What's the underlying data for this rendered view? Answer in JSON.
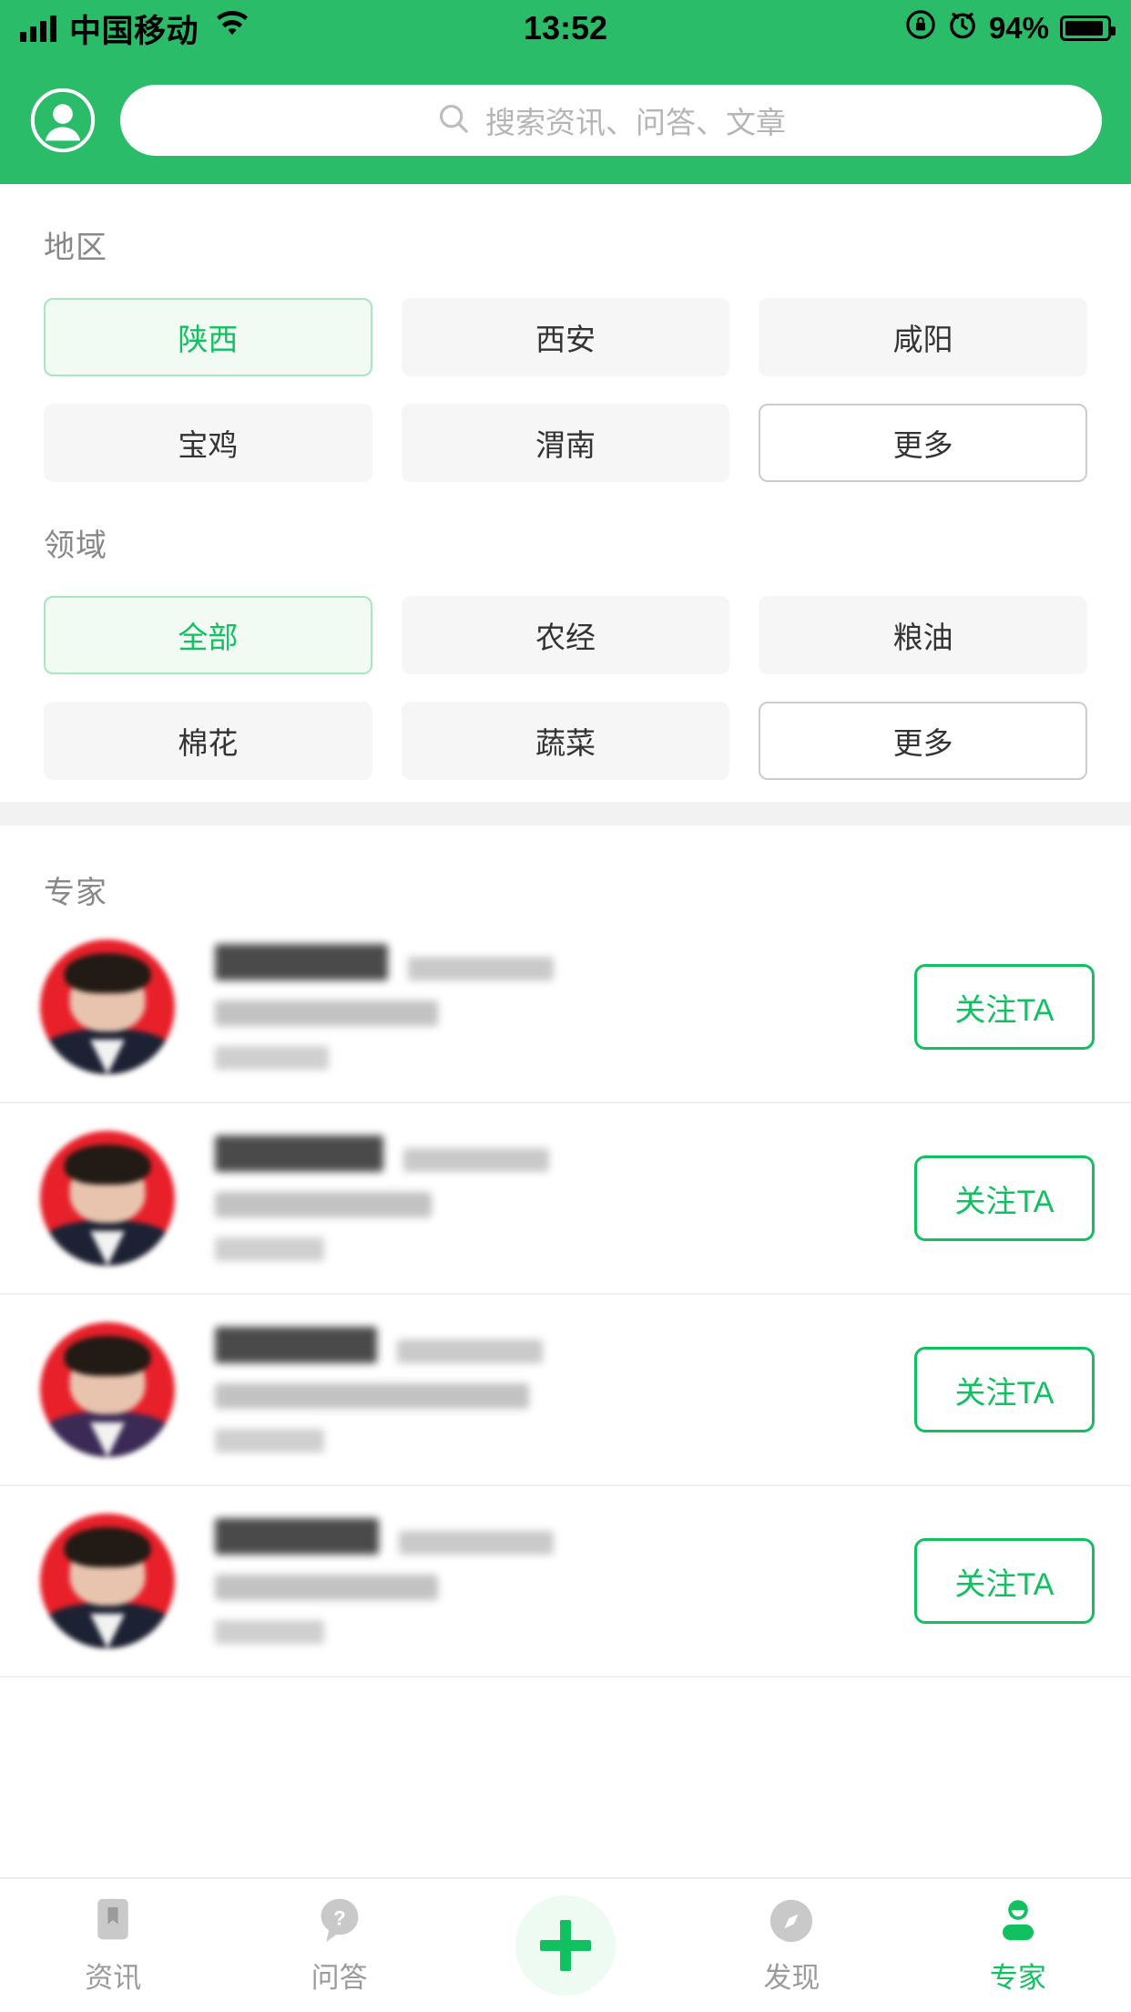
{
  "status_bar": {
    "carrier": "中国移动",
    "time": "13:52",
    "battery_percent": "94%",
    "battery_level": 94,
    "icons": [
      "signal-icon",
      "wifi-icon",
      "rotation-lock-icon",
      "alarm-icon",
      "battery-icon"
    ]
  },
  "header": {
    "avatar_icon": "user-circle-icon",
    "search": {
      "icon": "search-icon",
      "placeholder": "搜索资讯、问答、文章",
      "value": ""
    },
    "accent_color": "#2abc68"
  },
  "filters": {
    "region": {
      "title": "地区",
      "options": [
        {
          "label": "陕西",
          "selected": true,
          "type": "normal"
        },
        {
          "label": "西安",
          "selected": false,
          "type": "normal"
        },
        {
          "label": "咸阳",
          "selected": false,
          "type": "normal"
        },
        {
          "label": "宝鸡",
          "selected": false,
          "type": "normal"
        },
        {
          "label": "渭南",
          "selected": false,
          "type": "normal"
        },
        {
          "label": "更多",
          "selected": false,
          "type": "more"
        }
      ]
    },
    "field": {
      "title": "领域",
      "options": [
        {
          "label": "全部",
          "selected": true,
          "type": "normal"
        },
        {
          "label": "农经",
          "selected": false,
          "type": "normal"
        },
        {
          "label": "粮油",
          "selected": false,
          "type": "normal"
        },
        {
          "label": "棉花",
          "selected": false,
          "type": "normal"
        },
        {
          "label": "蔬菜",
          "selected": false,
          "type": "normal"
        },
        {
          "label": "更多",
          "selected": false,
          "type": "more"
        }
      ]
    },
    "selected_color": "#11c160",
    "chip_bg": "#f6f6f6"
  },
  "experts": {
    "title": "专家",
    "follow_label": "关注TA",
    "list": [
      {
        "name_redacted": true,
        "name_width": 190,
        "meta_width": 160,
        "org_width": 245,
        "tag_width": 125,
        "avatar": {
          "bg": "#e8202a",
          "clothing": "#1c2233"
        }
      },
      {
        "name_redacted": true,
        "name_width": 185,
        "meta_width": 160,
        "org_width": 238,
        "tag_width": 120,
        "avatar": {
          "bg": "#e8202a",
          "clothing": "#1c2233"
        }
      },
      {
        "name_redacted": true,
        "name_width": 178,
        "meta_width": 160,
        "org_width": 345,
        "tag_width": 120,
        "avatar": {
          "bg": "#e8202a",
          "clothing": "#3b2a55"
        }
      },
      {
        "name_redacted": true,
        "name_width": 180,
        "meta_width": 170,
        "org_width": 245,
        "tag_width": 120,
        "avatar": {
          "bg": "#e8202a",
          "clothing": "#1c2233"
        }
      }
    ]
  },
  "tabbar": {
    "items": [
      {
        "label": "资讯",
        "icon": "bookmark-icon",
        "active": false
      },
      {
        "label": "问答",
        "icon": "question-mark-icon",
        "active": false
      },
      {
        "label": "",
        "icon": "plus-icon",
        "active": false
      },
      {
        "label": "发现",
        "icon": "compass-icon",
        "active": false
      },
      {
        "label": "专家",
        "icon": "person-icon",
        "active": true
      }
    ],
    "active_color": "#11c160",
    "inactive_color": "#c9c9c9"
  }
}
